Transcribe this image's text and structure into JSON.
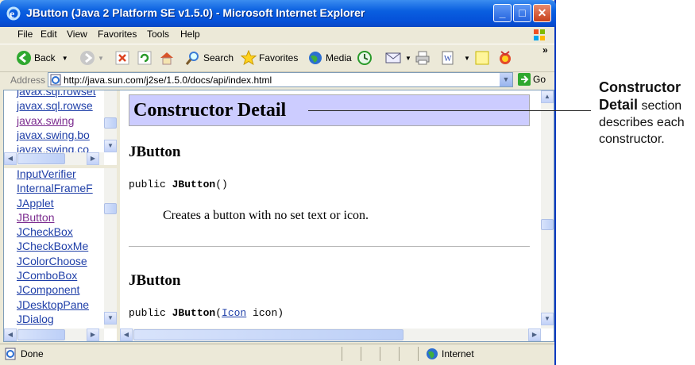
{
  "window": {
    "title": "JButton (Java 2 Platform SE v1.5.0) - Microsoft Internet Explorer",
    "controls": {
      "minimize": "_",
      "maximize": "□",
      "close": "✕"
    }
  },
  "menu": [
    "File",
    "Edit",
    "View",
    "Favorites",
    "Tools",
    "Help"
  ],
  "toolbar": {
    "back": "Back",
    "search": "Search",
    "favorites": "Favorites",
    "media": "Media",
    "more": "»"
  },
  "address": {
    "label": "Address",
    "url": "http://java.sun.com/j2se/1.5.0/docs/api/index.html",
    "go": "Go"
  },
  "packages": [
    "javax.sql.rowset",
    "javax.sql.rowse",
    "javax.swing",
    "javax.swing.bo",
    "javax.swing.co"
  ],
  "classes": [
    "InputVerifier",
    "InternalFrameF",
    "JApplet",
    "JButton",
    "JCheckBox",
    "JCheckBoxMe",
    "JColorChoose",
    "JComboBox",
    "JComponent",
    "JDesktopPane",
    "JDialog"
  ],
  "doc": {
    "section_title": "Constructor Detail",
    "c1_name": "JButton",
    "c1_prefix": "public ",
    "c1_method": "JButton",
    "c1_params": "()",
    "c1_desc": "Creates a button with no set text or icon.",
    "c2_name": "JButton",
    "c2_prefix": "public ",
    "c2_method": "JButton",
    "c2_open": "(",
    "c2_type": "Icon",
    "c2_rest": " icon)"
  },
  "status": {
    "text": "Done",
    "zone": "Internet"
  },
  "annotation": {
    "bold": "Constructor Detail",
    "rest": " section describes each constructor."
  },
  "colors": {
    "title_blue": "#0a5fe0",
    "section_bg": "#ccccff",
    "link": "#1f3fa8",
    "visited": "#7b2b8f"
  }
}
